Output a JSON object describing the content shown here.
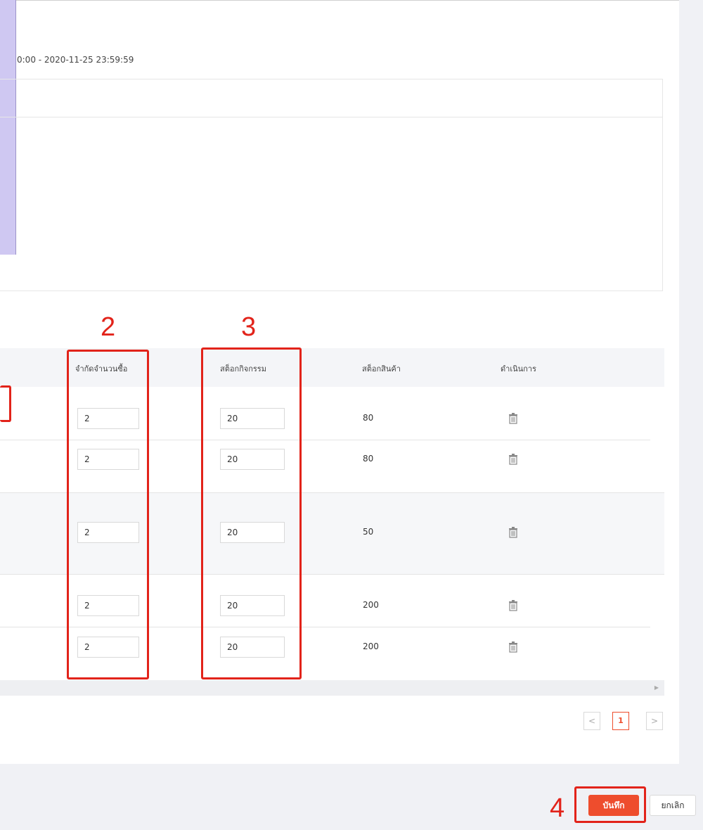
{
  "period_text": "0:00 - 2020-11-25 23:59:59",
  "table": {
    "headers": {
      "purchase_limit": "จำกัดจำนวนซื้อ",
      "campaign_stock": "สต็อกกิจกรรม",
      "product_stock": "สต็อกสินค้า",
      "action": "ดำเนินการ"
    },
    "rows": [
      {
        "purchase_limit": "2",
        "campaign_stock": "20",
        "product_stock": "80"
      },
      {
        "purchase_limit": "2",
        "campaign_stock": "20",
        "product_stock": "80"
      },
      {
        "purchase_limit": "2",
        "campaign_stock": "20",
        "product_stock": "50"
      },
      {
        "purchase_limit": "2",
        "campaign_stock": "20",
        "product_stock": "200"
      },
      {
        "purchase_limit": "2",
        "campaign_stock": "20",
        "product_stock": "200"
      }
    ]
  },
  "pagination": {
    "prev": "<",
    "current": "1",
    "next": ">"
  },
  "annotations": {
    "a2": "2",
    "a3": "3",
    "a4": "4"
  },
  "buttons": {
    "save": "บันทึก",
    "cancel": "ยกเลิก"
  },
  "icons": {
    "delete": "trash-icon",
    "scroll_right": "caret-right-icon"
  },
  "colors": {
    "accent": "#ee4d2d",
    "annotation": "#e2231a"
  }
}
